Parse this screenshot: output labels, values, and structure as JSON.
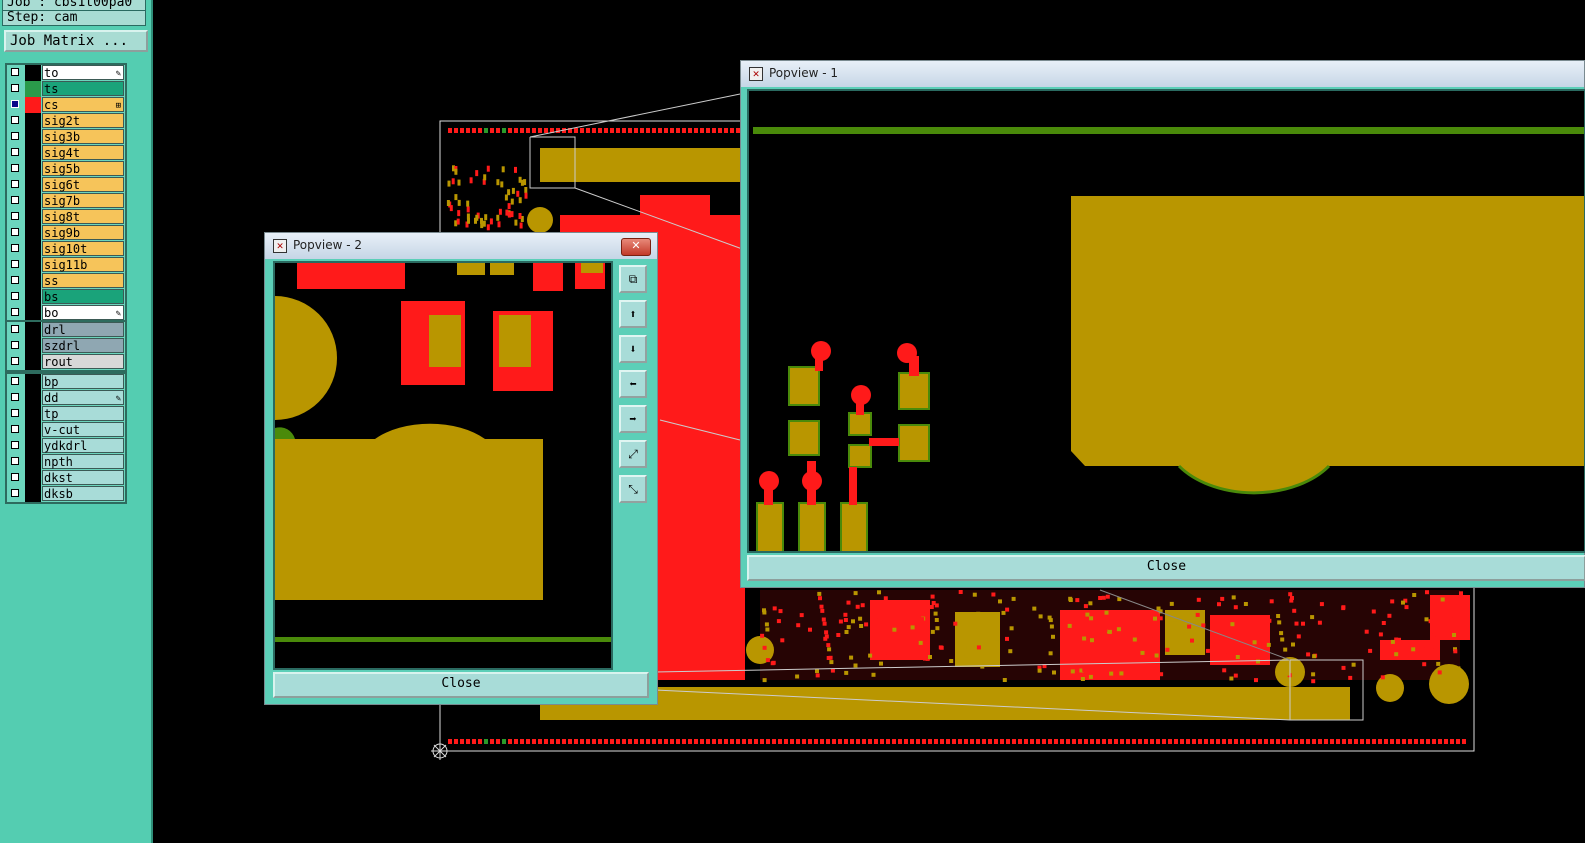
{
  "header": {
    "job_line": "Job : cbs1t00pa0",
    "step_line": "Step: cam",
    "job_matrix_label": "Job Matrix ..."
  },
  "layers_group1": [
    {
      "name": "to",
      "color": "#000000",
      "bg": "#ffffff",
      "icon": "edit-icon"
    },
    {
      "name": "ts",
      "color": "#2a9a4a",
      "bg": "#1aa37a",
      "icon": ""
    },
    {
      "name": "cs",
      "color": "#ff1a1a",
      "bg": "#f6c45a",
      "icon": "expand-icon",
      "selected": true
    },
    {
      "name": "sig2t",
      "color": "#000000",
      "bg": "#f6c45a",
      "icon": ""
    },
    {
      "name": "sig3b",
      "color": "#000000",
      "bg": "#f6c45a",
      "icon": ""
    },
    {
      "name": "sig4t",
      "color": "#000000",
      "bg": "#f6c45a",
      "icon": ""
    },
    {
      "name": "sig5b",
      "color": "#000000",
      "bg": "#f6c45a",
      "icon": ""
    },
    {
      "name": "sig6t",
      "color": "#000000",
      "bg": "#f6c45a",
      "icon": ""
    },
    {
      "name": "sig7b",
      "color": "#000000",
      "bg": "#f6c45a",
      "icon": ""
    },
    {
      "name": "sig8t",
      "color": "#000000",
      "bg": "#f6c45a",
      "icon": ""
    },
    {
      "name": "sig9b",
      "color": "#000000",
      "bg": "#f6c45a",
      "icon": ""
    },
    {
      "name": "sig10t",
      "color": "#000000",
      "bg": "#f6c45a",
      "icon": ""
    },
    {
      "name": "sig11b",
      "color": "#000000",
      "bg": "#f6c45a",
      "icon": ""
    },
    {
      "name": "ss",
      "color": "#000000",
      "bg": "#f6c45a",
      "icon": ""
    },
    {
      "name": "bs",
      "color": "#000000",
      "bg": "#1aa37a",
      "icon": ""
    },
    {
      "name": "bo",
      "color": "#000000",
      "bg": "#ffffff",
      "icon": "edit-icon"
    }
  ],
  "layers_group2": [
    {
      "name": "drl",
      "color": "#000000",
      "bg": "#8fa7b2",
      "icon": ""
    },
    {
      "name": "szdrl",
      "color": "#000000",
      "bg": "#8fa7b2",
      "icon": ""
    },
    {
      "name": "rout",
      "color": "#000000",
      "bg": "#d8d8d8",
      "icon": ""
    }
  ],
  "layers_group3": [
    {
      "name": "bp",
      "color": "#000000",
      "bg": "#a8dcd8",
      "icon": ""
    },
    {
      "name": "dd",
      "color": "#000000",
      "bg": "#a8dcd8",
      "icon": "edit-icon"
    },
    {
      "name": "tp",
      "color": "#000000",
      "bg": "#a8dcd8",
      "icon": ""
    },
    {
      "name": "v-cut",
      "color": "#000000",
      "bg": "#a8dcd8",
      "icon": ""
    },
    {
      "name": "ydkdrl",
      "color": "#000000",
      "bg": "#a8dcd8",
      "icon": ""
    },
    {
      "name": "npth",
      "color": "#000000",
      "bg": "#a8dcd8",
      "icon": ""
    },
    {
      "name": "dkst",
      "color": "#000000",
      "bg": "#a8dcd8",
      "icon": ""
    },
    {
      "name": "dksb",
      "color": "#000000",
      "bg": "#a8dcd8",
      "icon": ""
    }
  ],
  "popview1": {
    "title": "Popview - 1",
    "close_label": "Close"
  },
  "popview2": {
    "title": "Popview - 2",
    "close_label": "Close",
    "tools": [
      "zoom-window-icon",
      "pan-up-icon",
      "pan-down-icon",
      "pan-left-icon",
      "pan-right-icon",
      "zoom-in-icon",
      "zoom-out-icon"
    ]
  },
  "colors": {
    "copper": "#b99600",
    "pad_red": "#ff1a1a",
    "outline_green": "#4a8a0a",
    "panel": "#54cdb1"
  }
}
